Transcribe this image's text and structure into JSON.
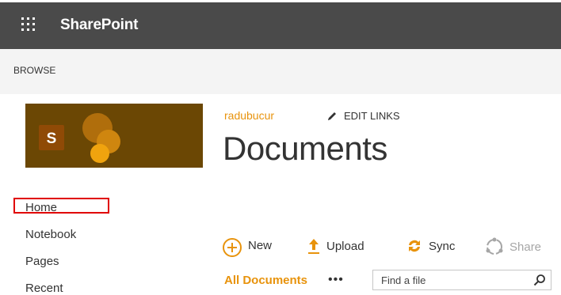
{
  "suite_bar": {
    "app_name": "SharePoint",
    "background_color": "#4a4a4a",
    "launcher_icon": "app-launcher-waffle-icon"
  },
  "ribbon": {
    "tabs": [
      {
        "label": "BROWSE"
      }
    ]
  },
  "site": {
    "logo_letter": "S",
    "logo_color": "#6b4704",
    "breadcrumb": "radubucur",
    "edit_links_label": "EDIT LINKS",
    "page_title": "Documents"
  },
  "quick_launch": {
    "items": [
      {
        "label": "Home",
        "highlighted": true
      },
      {
        "label": "Notebook"
      },
      {
        "label": "Pages"
      },
      {
        "label": "Recent"
      }
    ],
    "highlight_color": "#e00000"
  },
  "command_bar": {
    "new_label": "New",
    "upload_label": "Upload",
    "sync_label": "Sync",
    "share_label": "Share",
    "accent_color": "#e8930c"
  },
  "view_bar": {
    "current_view": "All Documents",
    "more_label": "•••",
    "search": {
      "placeholder": "Find a file",
      "value": ""
    }
  }
}
